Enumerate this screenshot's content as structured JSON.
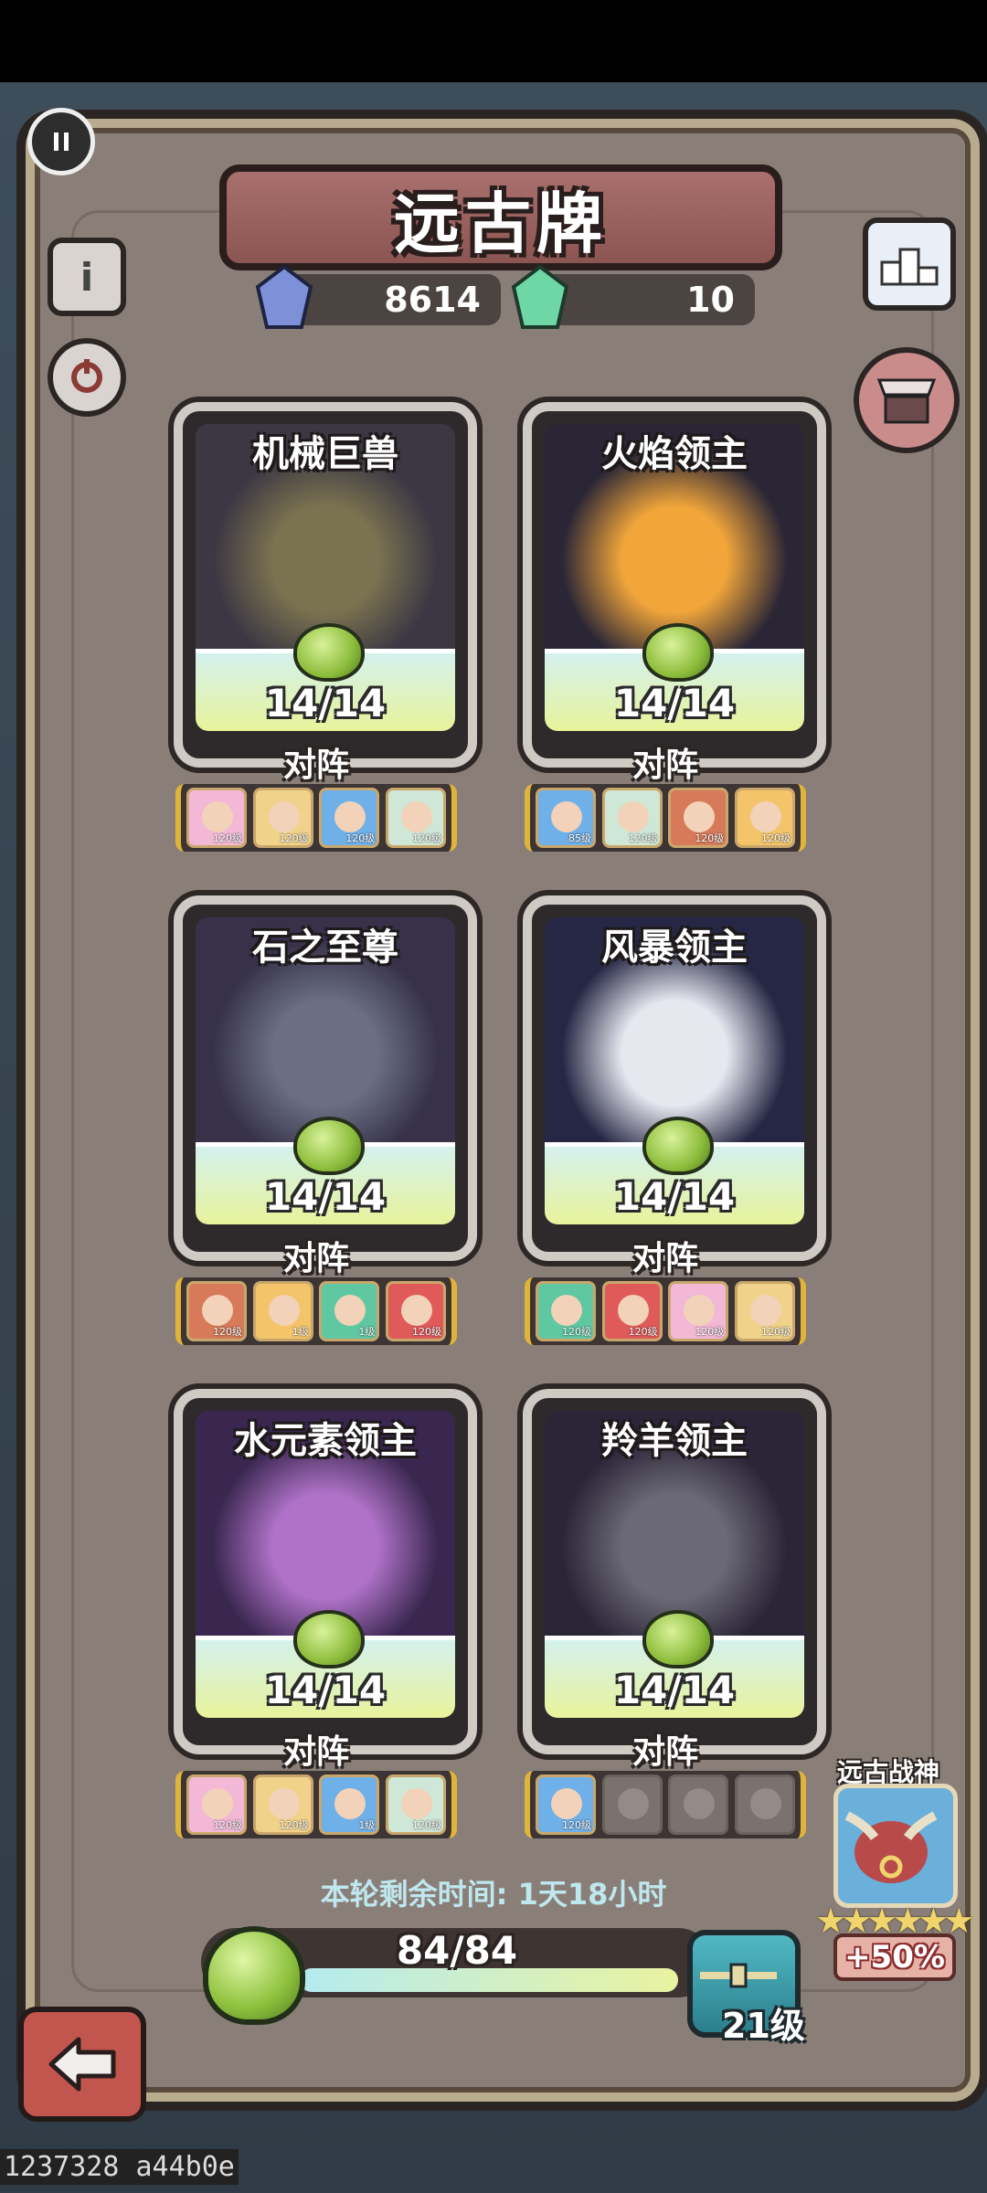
{
  "title": "远古牌",
  "currency": {
    "blue_gem": "8614",
    "green_gem": "10"
  },
  "cards": [
    {
      "name": "机械巨兽",
      "progress": "14/14",
      "team_label": "对阵",
      "heroes": [
        "120级",
        "120级",
        "120级",
        "120级"
      ]
    },
    {
      "name": "火焰领主",
      "progress": "14/14",
      "team_label": "对阵",
      "heroes": [
        "85级",
        "120级",
        "120级",
        "120级"
      ]
    },
    {
      "name": "石之至尊",
      "progress": "14/14",
      "team_label": "对阵",
      "heroes": [
        "120级",
        "1级",
        "1级",
        "120级"
      ]
    },
    {
      "name": "风暴领主",
      "progress": "14/14",
      "team_label": "对阵",
      "heroes": [
        "120级",
        "120级",
        "120级",
        "120级"
      ]
    },
    {
      "name": "水元素领主",
      "progress": "14/14",
      "team_label": "对阵",
      "heroes": [
        "120级",
        "120级",
        "1级",
        "120级"
      ]
    },
    {
      "name": "羚羊领主",
      "progress": "14/14",
      "team_label": "对阵",
      "heroes": [
        "120级"
      ]
    }
  ],
  "round_timer": "本轮剩余时间: 1天18小时",
  "total_progress": {
    "text": "84/84",
    "fraction": 1.0
  },
  "chest_level": "21级",
  "deity": {
    "title": "远古战神",
    "stars": 6,
    "bonus": "+50%"
  },
  "footer_id": "1237328 a44b0e",
  "colors": {
    "board": "#8a7f78",
    "title_plate": "#9e6561",
    "bar_start": "#b4ebf0",
    "bar_end": "#e9f3a0"
  }
}
